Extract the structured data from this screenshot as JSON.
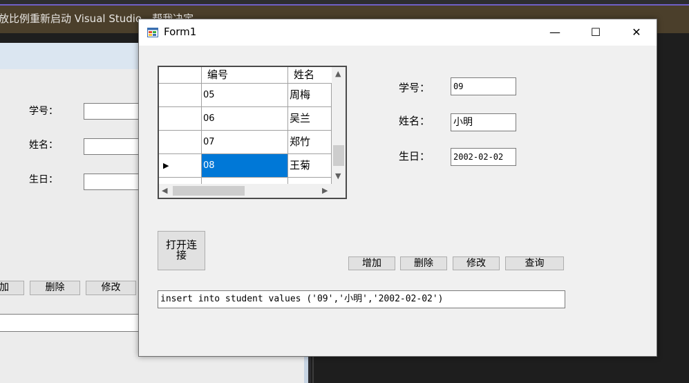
{
  "vs": {
    "infobar_text": "放比例重新启动 Visual Studio。帮我决定"
  },
  "designer": {
    "labels": {
      "student_id": "学号：",
      "name": "姓名：",
      "birthday": "生日："
    },
    "buttons": {
      "add": "加",
      "delete": "删除",
      "modify": "修改"
    }
  },
  "form": {
    "title": "Form1",
    "controls": {
      "minimize": "—",
      "maximize": "☐",
      "close": "✕"
    },
    "grid": {
      "columns": [
        "编号",
        "姓名"
      ],
      "rows": [
        {
          "id": "05",
          "name": "周梅",
          "selected": false,
          "current": false
        },
        {
          "id": "06",
          "name": "吴兰",
          "selected": false,
          "current": false
        },
        {
          "id": "07",
          "name": "郑竹",
          "selected": false,
          "current": false
        },
        {
          "id": "08",
          "name": "王菊",
          "selected": true,
          "current": true
        }
      ],
      "current_row_glyph": "▶",
      "scroll_up": "▲",
      "scroll_down": "▼",
      "scroll_left": "◀",
      "scroll_right": "▶"
    },
    "labels": {
      "student_id": "学号：",
      "name": "姓名：",
      "birthday": "生日："
    },
    "inputs": {
      "student_id": "09",
      "name": "小明",
      "birthday": "2002-02-02"
    },
    "buttons": {
      "open_connection": "打开连接",
      "add": "增加",
      "delete": "删除",
      "modify": "修改",
      "query": "查询"
    },
    "sql_text": "insert into student values ('09','小明','2002-02-02')"
  },
  "colors": {
    "selection": "#0078d7",
    "vs_accent": "#6f5fc7",
    "infobar_bg": "#4b3f2b"
  }
}
